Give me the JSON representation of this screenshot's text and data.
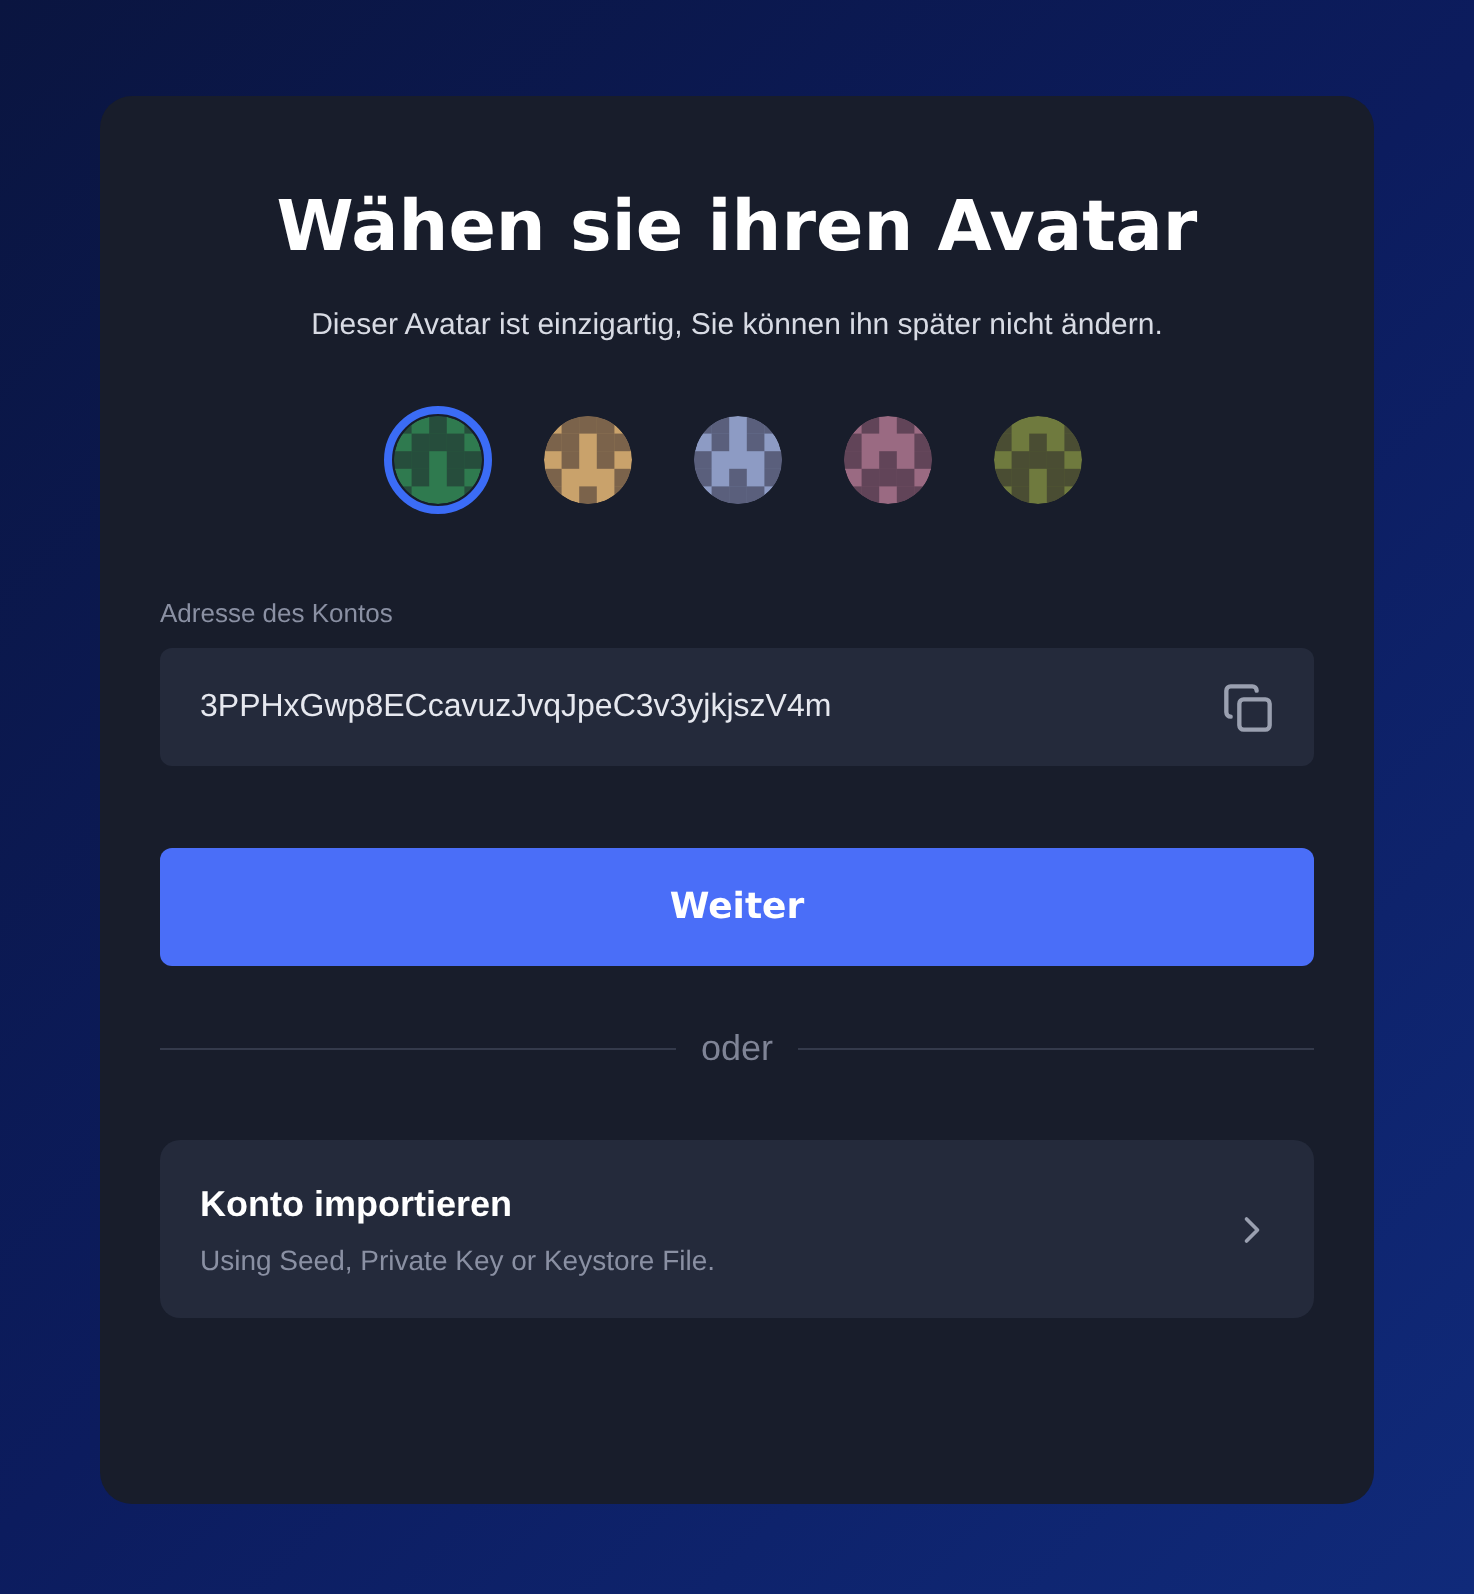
{
  "title": "Wähen sie ihren Avatar",
  "subtitle": "Dieser Avatar ist einzigartig, Sie können ihn später nicht ändern.",
  "avatars": [
    {
      "selected": true,
      "color": "#2f7a4f"
    },
    {
      "selected": false,
      "color": "#c9a26b"
    },
    {
      "selected": false,
      "color": "#8d9bc4"
    },
    {
      "selected": false,
      "color": "#9a6a82"
    },
    {
      "selected": false,
      "color": "#6f7a3e"
    }
  ],
  "address": {
    "label": "Adresse des Kontos",
    "value": "3PPHxGwp8ECcavuzJvqJpeC3v3yjkjszV4m"
  },
  "continue_button": "Weiter",
  "divider": "oder",
  "import": {
    "title": "Konto importieren",
    "subtitle": "Using Seed, Private Key or Keystore File."
  }
}
